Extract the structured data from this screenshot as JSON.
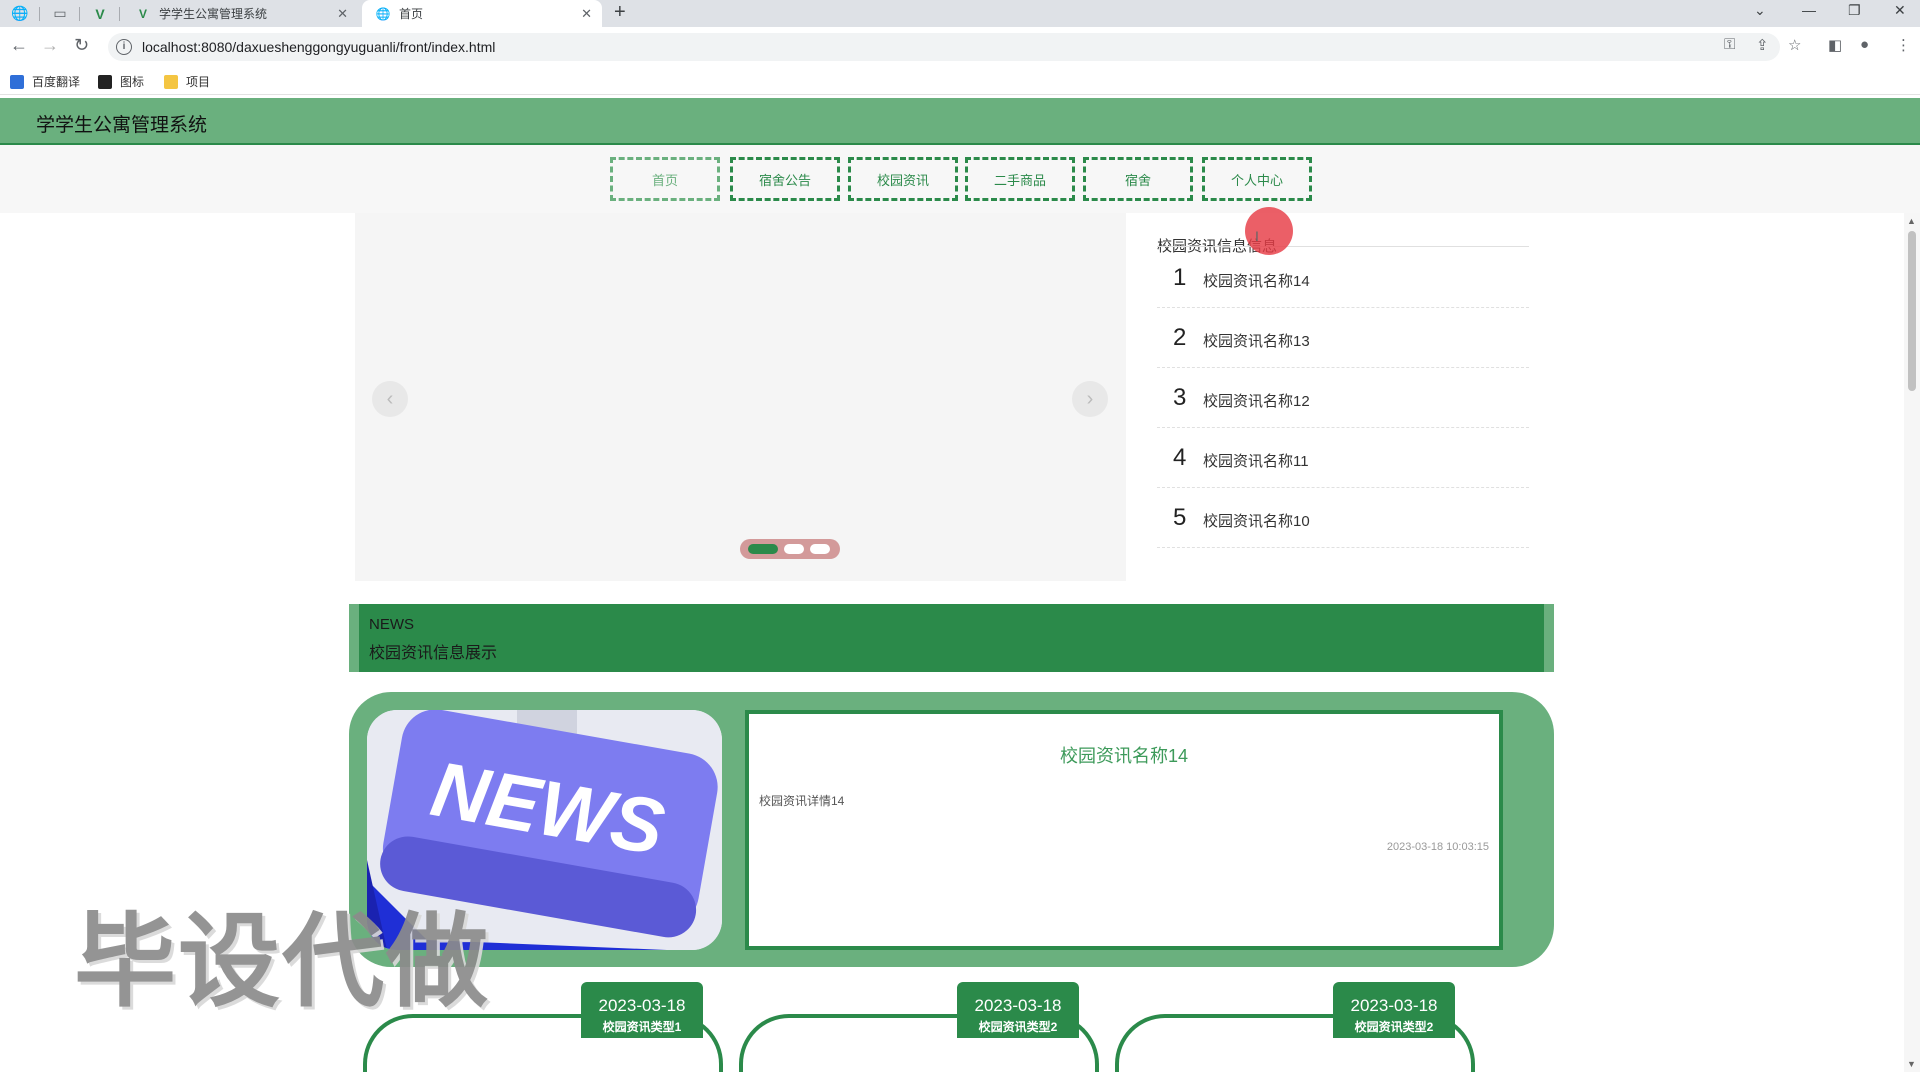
{
  "browser": {
    "tabs": [
      {
        "title": "学学生公寓管理系统",
        "active": false
      },
      {
        "title": "首页",
        "active": true
      }
    ],
    "url": "localhost:8080/daxueshenggongyuguanli/front/index.html",
    "bookmarks": [
      "百度翻译",
      "图标",
      "项目"
    ]
  },
  "site": {
    "title": "学学生公寓管理系统"
  },
  "nav": {
    "items": [
      "首页",
      "宿舍公告",
      "校园资讯",
      "二手商品",
      "宿舍",
      "个人中心"
    ]
  },
  "sidebar": {
    "title": "校园资讯信息信息",
    "items": [
      {
        "num": "1",
        "name": "校园资讯名称14"
      },
      {
        "num": "2",
        "name": "校园资讯名称13"
      },
      {
        "num": "3",
        "name": "校园资讯名称12"
      },
      {
        "num": "4",
        "name": "校园资讯名称11"
      },
      {
        "num": "5",
        "name": "校园资讯名称10"
      }
    ]
  },
  "news_banner": {
    "en": "NEWS",
    "cn": "校园资讯信息展示"
  },
  "featured": {
    "image_text": "NEWS",
    "title": "校园资讯名称14",
    "desc": "校园资讯详情14",
    "time": "2023-03-18 10:03:15"
  },
  "watermark": "毕设代做",
  "cards": [
    {
      "date": "2023-03-18",
      "type": "校园资讯类型1"
    },
    {
      "date": "2023-03-18",
      "type": "校园资讯类型2"
    },
    {
      "date": "2023-03-18",
      "type": "校园资讯类型2"
    }
  ],
  "colors": {
    "primary": "#2b8a4a",
    "light": "#6ab07e"
  }
}
